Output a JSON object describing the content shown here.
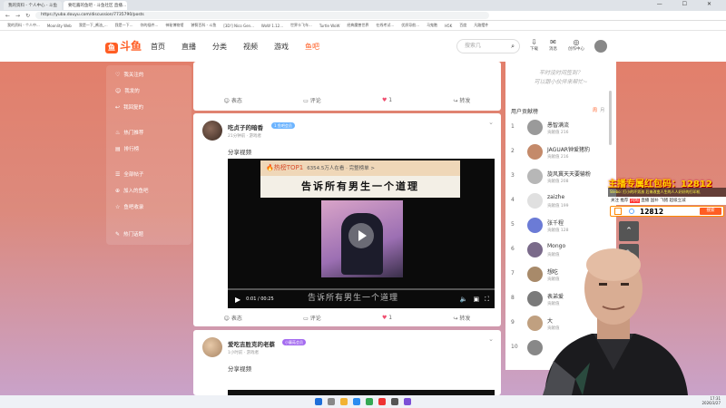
{
  "browser": {
    "tabs": [
      "我的资料 - 个人中心 - 斗鱼",
      "要吃酱的鱼吧 - 斗鱼社区 直播..."
    ],
    "url": "https://yuba.douyu.com/discussion/7735790/posts",
    "bookmarks": [
      "我的资料 - 个人中...",
      "Moonlity Web",
      "我是一下_酱油_...",
      "我是一下...",
      "你的插件...",
      "神秘博物馆",
      "饕餮百科 - 斗鱼",
      "[3D!] Nico Gen...",
      "WoW 1.12...",
      "世界卡飞车...",
      "Turtle WoW",
      "经典魔兽世界",
      "在线考试...",
      "优质导航...",
      "马鬼胞",
      "H5K",
      "百度",
      "凡路摆件"
    ],
    "window_controls": "— ☐ ✕"
  },
  "header": {
    "logo": "斗鱼",
    "nav": [
      "首页",
      "直播",
      "分类",
      "视频",
      "游戏",
      "鱼吧"
    ],
    "search_placeholder": "搜索几",
    "icons": [
      {
        "name": "download-icon",
        "label": "下载"
      },
      {
        "name": "message-icon",
        "label": "消息",
        "badge": "1"
      },
      {
        "name": "creator-icon",
        "label": "创作中心"
      }
    ]
  },
  "sidebar": {
    "items": [
      {
        "icon": "heart-icon",
        "label": "我关注的"
      },
      {
        "icon": "user-icon",
        "label": "我发的"
      },
      {
        "icon": "reply-icon",
        "label": "我回复的"
      },
      {
        "icon": "fire-icon",
        "label": "热门推荐"
      },
      {
        "icon": "rank-icon",
        "label": "排行榜"
      },
      {
        "icon": "post-icon",
        "label": "全部帖子"
      },
      {
        "icon": "join-icon",
        "label": "加入的鱼吧"
      },
      {
        "icon": "star-icon",
        "label": "鱼吧收录"
      },
      {
        "icon": "edit-icon",
        "label": "热门话题"
      }
    ]
  },
  "card_actions": {
    "share": "表态",
    "comment": "评论",
    "like_count": "1",
    "forward": "转发"
  },
  "posts": [
    {
      "name": "吃贞子的暗香",
      "badge": "1 鱼吧会员",
      "meta": "21分钟前 · 游戏者",
      "text": "分享视频",
      "video": {
        "hot_title": "🔥热榜TOP1",
        "hot_sub": "6354.5万人在看 · 完整榜单 >",
        "banner": "告诉所有男生一个道理",
        "subtitle": "告诉所有男生一个道理",
        "time": "0:01 / 00:25"
      }
    },
    {
      "name": "爱吃吉胜克的老蔡",
      "badge": "小蘑菇会员",
      "meta": "1小时前 · 游戏者",
      "text": "分享视频"
    }
  ],
  "right_panel": {
    "promo_line1": "平时没时间签到？",
    "promo_line2": "可以跟小伙伴来帮忙~",
    "contrib_title": "用户贡献榜",
    "contrib_tabs": [
      "周",
      "月"
    ],
    "contributors": [
      {
        "rank": "1",
        "name": "愚智满流",
        "value": "贡献值 216"
      },
      {
        "rank": "2",
        "name": "JAGUAR钟爱猪豹",
        "value": "贡献值 216"
      },
      {
        "rank": "3",
        "name": "旋风冀天天要输粉",
        "value": "贡献值 208"
      },
      {
        "rank": "4",
        "name": "zaizhe",
        "value": "贡献值 199"
      },
      {
        "rank": "5",
        "name": "张千程",
        "value": "贡献值 128"
      },
      {
        "rank": "6",
        "name": "Mongo",
        "value": "贡献值"
      },
      {
        "rank": "7",
        "name": "想吃",
        "value": "贡献值"
      },
      {
        "rank": "8",
        "name": "表弟爱",
        "value": "贡献值"
      },
      {
        "rank": "9",
        "name": "大",
        "value": "贡献值"
      },
      {
        "rank": "10",
        "name": "",
        "value": ""
      }
    ]
  },
  "overlay": {
    "title": "主播专属红包码：12812",
    "danmu": "Stebo: 打小的坏男孩 后来改变人生的人人好好的打印机",
    "mini_nav": [
      "关注",
      "推荐",
      "闪购",
      "直播",
      "国补",
      "飞猪",
      "超级立减"
    ],
    "search_value": "12812",
    "search_button": "搜索"
  },
  "taskbar": {
    "time": "17:31",
    "date": "2026/3/27"
  }
}
